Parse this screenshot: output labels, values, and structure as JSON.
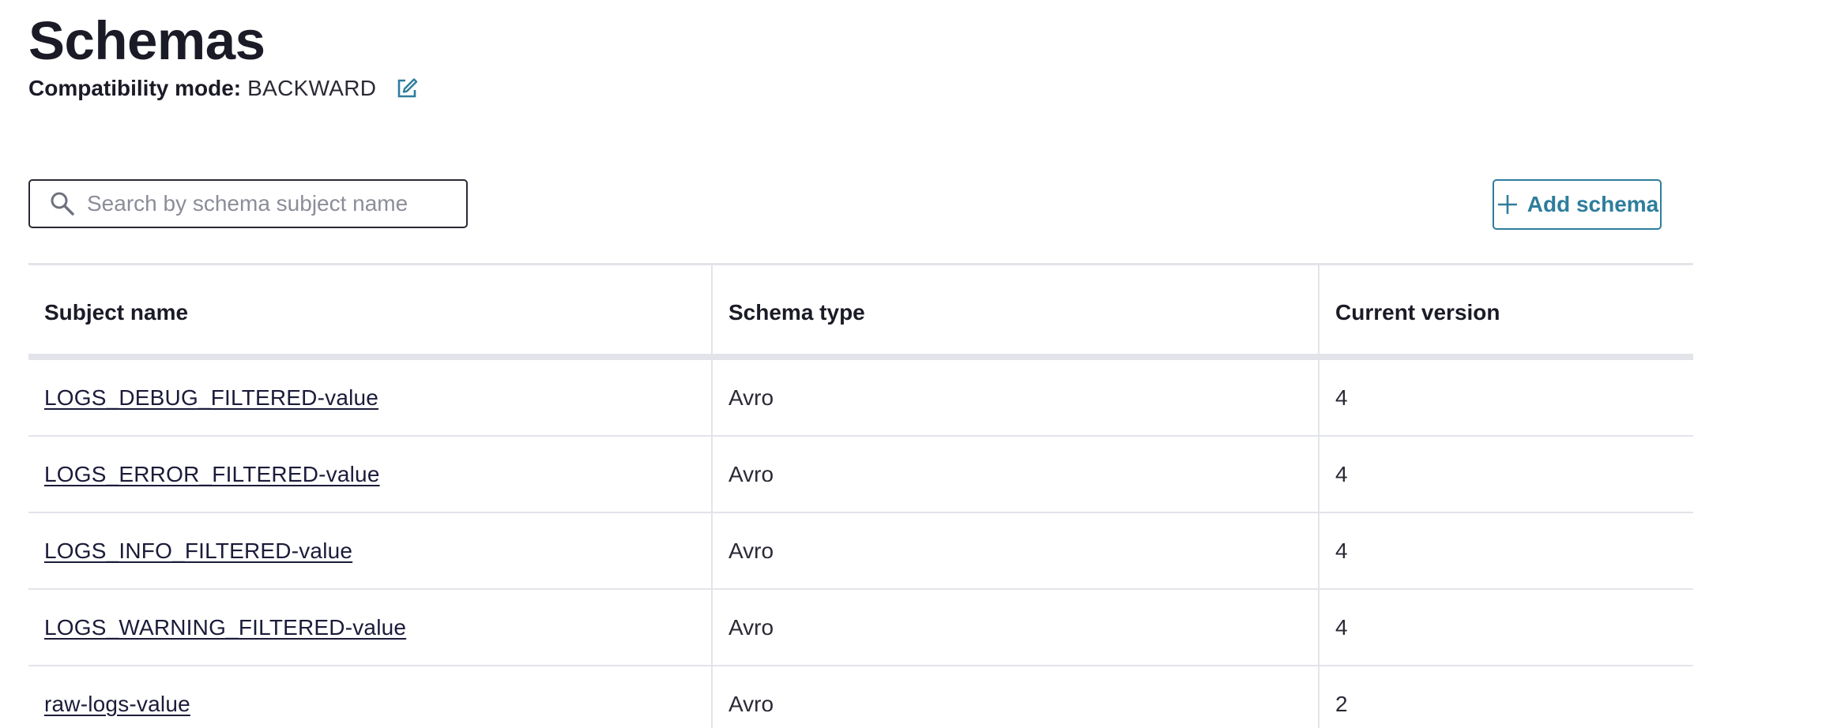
{
  "page": {
    "title": "Schemas",
    "compatibility_label": "Compatibility mode:",
    "compatibility_value": "BACKWARD"
  },
  "search": {
    "placeholder": "Search by schema subject name",
    "value": ""
  },
  "actions": {
    "add_schema_label": "Add schema"
  },
  "table": {
    "columns": [
      "Subject name",
      "Schema type",
      "Current version"
    ],
    "rows": [
      {
        "subject": "LOGS_DEBUG_FILTERED-value",
        "type": "Avro",
        "version": "4"
      },
      {
        "subject": "LOGS_ERROR_FILTERED-value",
        "type": "Avro",
        "version": "4"
      },
      {
        "subject": "LOGS_INFO_FILTERED-value",
        "type": "Avro",
        "version": "4"
      },
      {
        "subject": "LOGS_WARNING_FILTERED-value",
        "type": "Avro",
        "version": "4"
      },
      {
        "subject": "raw-logs-value",
        "type": "Avro",
        "version": "2"
      }
    ]
  },
  "icons": {
    "edit": "edit-icon",
    "search": "search-icon",
    "plus": "plus-icon"
  },
  "colors": {
    "accent": "#2e7d9c",
    "text": "#1b1b27",
    "border": "#e3e4ea",
    "placeholder": "#8b8d99"
  }
}
